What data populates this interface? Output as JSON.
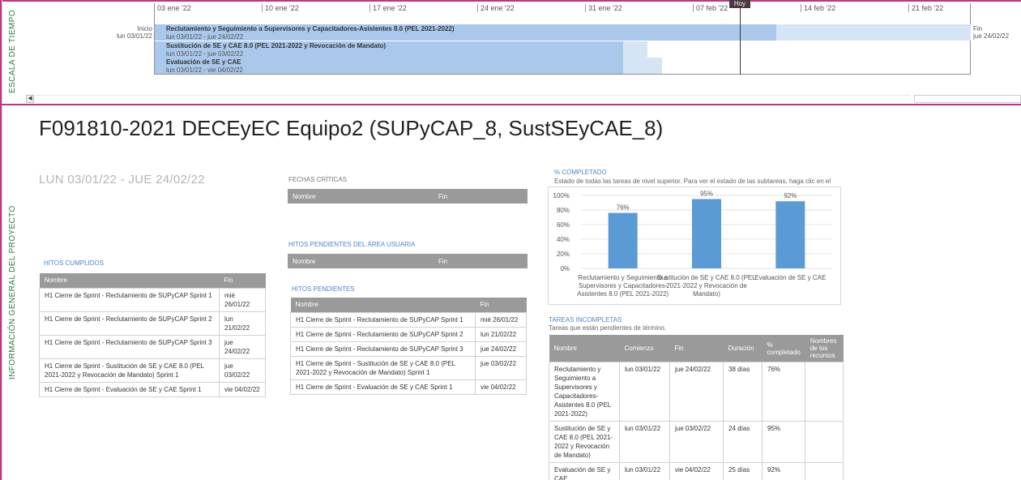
{
  "timeline": {
    "side_label": "ESCALA DE TIEMPO",
    "start_label": "Inicio",
    "start_date": "lun 03/01/22",
    "end_label": "Fin",
    "end_date": "jue 24/02/22",
    "today_label": "Hoy",
    "ticks": [
      "03 ene '22",
      "10 ene '22",
      "17 ene '22",
      "24 ene '22",
      "31 ene '22",
      "07 feb '22",
      "14 feb '22",
      "21 feb '22"
    ],
    "bars": [
      {
        "title": "Reclutamiento y Seguimiento a Supervisores y Capacitadores-Asistentes 8.0 (PEL 2021-2022)",
        "dates": "lun 03/01/22 - jue 24/02/22"
      },
      {
        "title": "Sustitución de SE y CAE 8.0 (PEL 2021-2022 y Revocación de Mandato)",
        "dates": "lun 03/01/22 - jue 03/02/22"
      },
      {
        "title": "Evaluación de SE y CAE",
        "dates": "lun 03/01/22 - vie 04/02/22"
      }
    ],
    "scroll_left_icon": "◀"
  },
  "report": {
    "side_label": "INFORMACIÓN GENERAL DEL PROYECTO",
    "title": "F091810-2021 DECEyEC Equipo2 (SUPyCAP_8, SustSEyCAE_8)",
    "date_range": "LUN 03/01/22 - JUE 24/02/22",
    "hitos_cumplidos": {
      "title": "HITOS CUMPLIDOS",
      "headers": [
        "Nombre",
        "Fin"
      ],
      "rows": [
        [
          "H1 Cierre de Sprint - Reclutamiento de SUPyCAP Sprint 1",
          "mié 26/01/22"
        ],
        [
          "H1 Cierre de Sprint - Reclutamiento de SUPyCAP Sprint 2",
          "lun 21/02/22"
        ],
        [
          "H1 Cierre de Sprint - Reclutamiento de SUPyCAP Sprint 3",
          "jue 24/02/22"
        ],
        [
          "H1 Cierre de Sprint - Sustitución de SE y CAE 8.0 (PEL 2021-2022 y Revocación de Mandato) Sprint 1",
          "jue 03/02/22"
        ],
        [
          "H1 Cierre de Sprint - Evaluación de SE y CAE Sprint 1",
          "vie 04/02/22"
        ]
      ]
    },
    "fechas_criticas": {
      "title": "FECHAS CRÍTICAS",
      "headers": [
        "Nombre",
        "Fin"
      ]
    },
    "hitos_area_usuaria": {
      "title": "HITOS PENDIENTES DEL ÁREA USUARIA",
      "headers": [
        "Nombre",
        "Fin"
      ]
    },
    "hitos_pendientes": {
      "title": "HITOS PENDIENTES",
      "headers": [
        "Nombre",
        "Fin"
      ],
      "rows": [
        [
          "H1 Cierre de Sprint - Reclutamiento de SUPyCAP Sprint 1",
          "mié 26/01/22"
        ],
        [
          "H1 Cierre de Sprint - Reclutamiento de SUPyCAP Sprint 2",
          "lun 21/02/22"
        ],
        [
          "H1 Cierre de Sprint - Reclutamiento de SUPyCAP Sprint 3",
          "jue 24/02/22"
        ],
        [
          "H1 Cierre de Sprint - Sustitución de SE y CAE 8.0 (PEL 2021-2022 y Revocación de Mandato) Sprint 1",
          "jue 03/02/22"
        ],
        [
          "H1 Cierre de Sprint - Evaluación de SE y CAE Sprint 1",
          "vie 04/02/22"
        ]
      ]
    },
    "completado": {
      "title": "% COMPLETADO",
      "description": "Estado de todas las tareas de nivel superior. Para ver el estado de las subtareas, haga clic en el gráfico y actualice el nivel de esquema en la Lista de campos."
    },
    "tareas_incompletas": {
      "title": "TAREAS INCOMPLETAS",
      "subtitle": "Tareas que están pendientes de término.",
      "headers": [
        "Nombre",
        "Comienzo",
        "Fin",
        "Duración",
        "% completado",
        "Nombres de los recursos"
      ],
      "rows": [
        [
          "Reclutamiento y Seguimiento a Supervisores y Capacitadores-Asistentes 8.0 (PEL 2021-2022)",
          "lun 03/01/22",
          "jue 24/02/22",
          "38 días",
          "76%",
          ""
        ],
        [
          "Sustitución de SE y CAE 8.0 (PEL 2021-2022 y Revocación de Mandato)",
          "lun 03/01/22",
          "jue 03/02/22",
          "24 días",
          "95%",
          ""
        ],
        [
          "Evaluación de SE y CAE",
          "lun 03/01/22",
          "vie 04/02/22",
          "25 días",
          "92%",
          ""
        ]
      ]
    }
  },
  "colors": {
    "accent_border": "#c0367f",
    "side_label": "#2c7a3a",
    "section_title": "#4a86c8",
    "bar": "#5b9bd5",
    "timeline_bar": "#a9c8eb",
    "table_header": "#9a9a9a"
  },
  "chart_data": {
    "type": "bar",
    "categories": [
      "Reclutamiento y Seguimiento a Supervisores y Capacitadores-Asistentes 8.0 (PEL 2021-2022)",
      "Sustitución de SE y CAE 8.0 (PEL 2021-2022 y Revocación de Mandato)",
      "Evaluación de SE y CAE"
    ],
    "category_lines": [
      [
        "Reclutamiento y Seguimiento a",
        "Supervisores y Capacitadores-",
        "Asistentes 8.0 (PEL 2021-2022)"
      ],
      [
        "Sustitución de SE y CAE 8.0 (PEL",
        "2021-2022 y Revocación de",
        "Mandato)"
      ],
      [
        "Evaluación de SE y CAE"
      ]
    ],
    "values": [
      76,
      95,
      92
    ],
    "data_labels": [
      "76%",
      "95%",
      "92%"
    ],
    "yticks": [
      "0%",
      "20%",
      "40%",
      "60%",
      "80%",
      "100%"
    ],
    "ylim": [
      0,
      100
    ],
    "grid": true,
    "title": "",
    "xlabel": "",
    "ylabel": ""
  }
}
